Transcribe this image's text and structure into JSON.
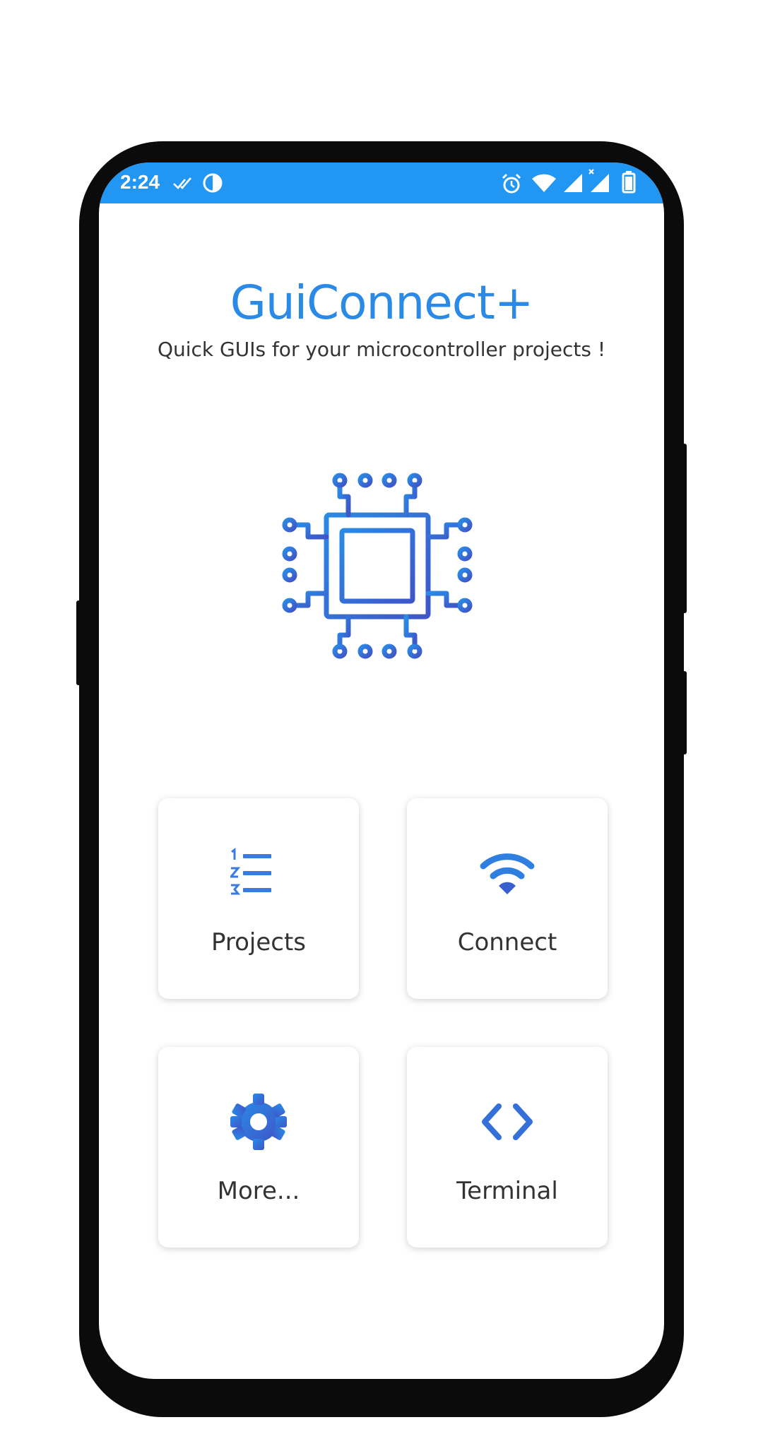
{
  "status_bar": {
    "time": "2:24",
    "icons": [
      "double-check-icon",
      "contrast-icon",
      "alarm-icon",
      "wifi-icon",
      "signal-icon",
      "signal-x-icon",
      "battery-icon"
    ],
    "background": "#2196F3"
  },
  "header": {
    "title": "GuiConnect+",
    "subtitle": "Quick GUIs for your microcontroller projects !"
  },
  "logo": {
    "icon": "microchip-icon",
    "accent": "#2a8ae6",
    "accent_dark": "#3f56c8"
  },
  "menu": [
    {
      "label": "Projects",
      "icon": "numbered-list-icon"
    },
    {
      "label": "Connect",
      "icon": "wifi-icon"
    },
    {
      "label": "More...",
      "icon": "gear-icon"
    },
    {
      "label": "Terminal",
      "icon": "code-icon"
    }
  ]
}
